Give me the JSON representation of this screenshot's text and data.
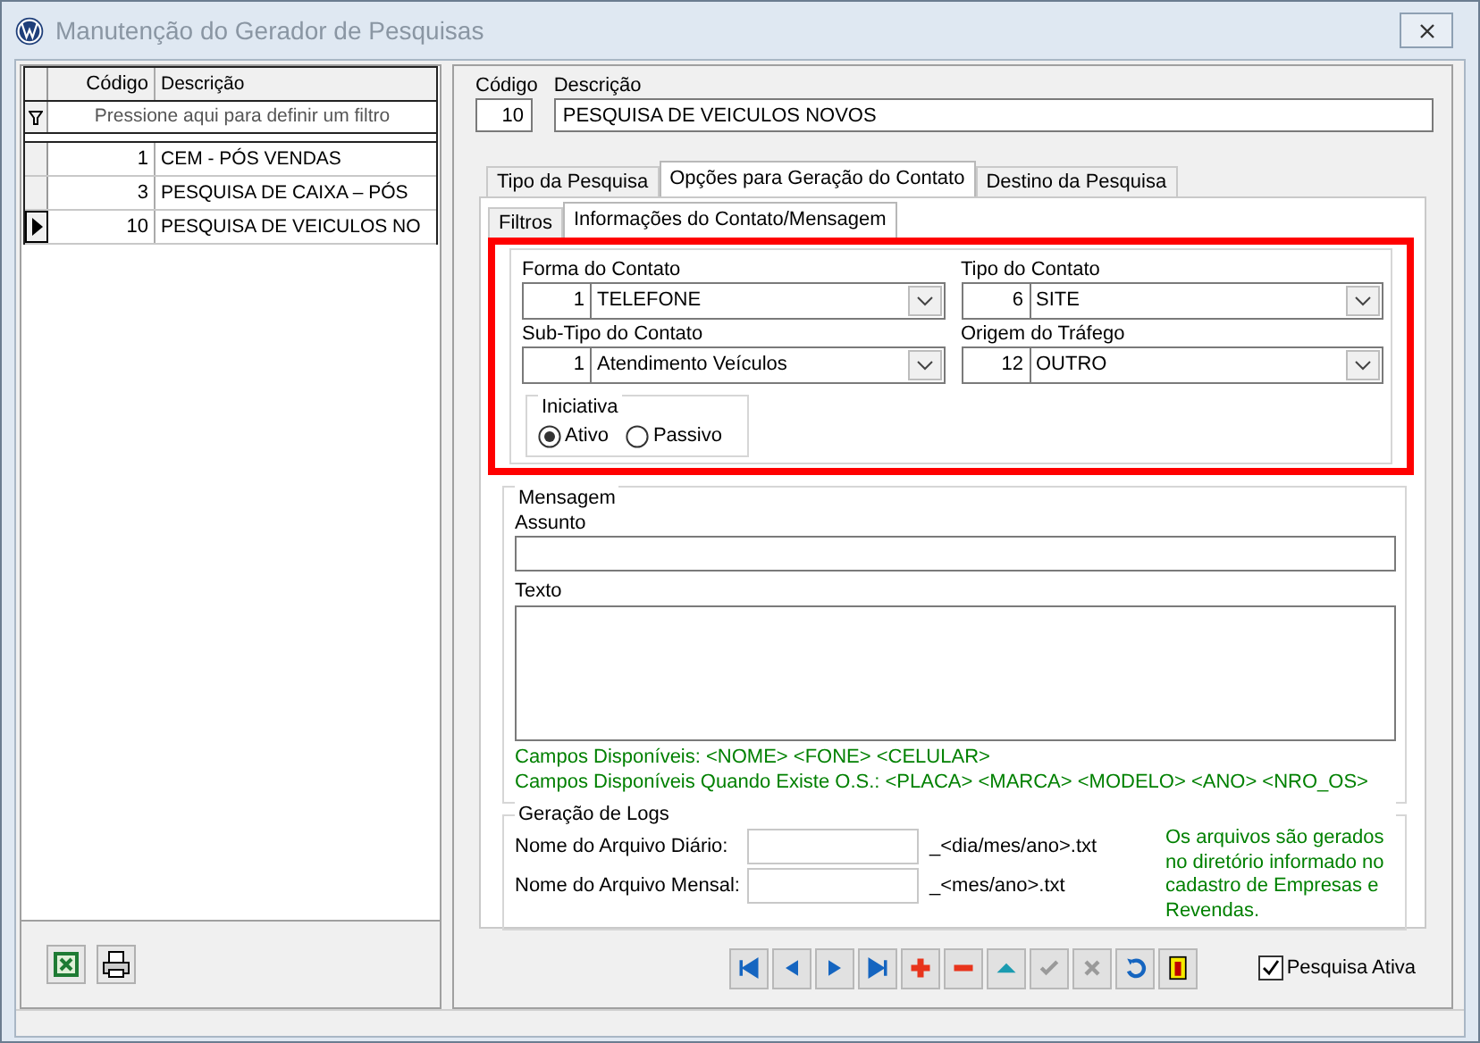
{
  "window": {
    "title": "Manutenção do Gerador de Pesquisas"
  },
  "grid": {
    "columns": [
      "Código",
      "Descrição"
    ],
    "filter_hint": "Pressione aqui para definir um filtro",
    "rows": [
      {
        "code": "1",
        "description": "CEM - PÓS VENDAS",
        "selected": false
      },
      {
        "code": "3",
        "description": "PESQUISA DE CAIXA – PÓS",
        "selected": false
      },
      {
        "code": "10",
        "description": "PESQUISA DE VEICULOS NO",
        "selected": true
      }
    ]
  },
  "record": {
    "code_label": "Código",
    "description_label": "Descrição",
    "code": "10",
    "description": "PESQUISA DE VEICULOS NOVOS"
  },
  "tabs": [
    {
      "label": "Tipo da Pesquisa",
      "selected": false
    },
    {
      "label": "Opções para Geração do Contato",
      "selected": true
    },
    {
      "label": "Destino da Pesquisa",
      "selected": false
    }
  ],
  "subtabs": [
    {
      "label": "Filtros",
      "selected": false
    },
    {
      "label": "Informações do Contato/Mensagem",
      "selected": true
    }
  ],
  "contact": {
    "highlighted": true,
    "fields": [
      {
        "label": "Forma do Contato",
        "code": "1",
        "value": "TELEFONE"
      },
      {
        "label": "Tipo do Contato",
        "code": "6",
        "value": "SITE"
      },
      {
        "label": "Sub-Tipo do Contato",
        "code": "1",
        "value": "Atendimento Veículos"
      },
      {
        "label": "Origem do Tráfego",
        "code": "12",
        "value": "OUTRO"
      }
    ],
    "initiative": {
      "title": "Iniciativa",
      "options": [
        {
          "label": "Ativo",
          "selected": true
        },
        {
          "label": "Passivo",
          "selected": false
        }
      ]
    }
  },
  "message": {
    "title": "Mensagem",
    "subject_label": "Assunto",
    "text_label": "Texto",
    "fields_line": "Campos Disponíveis:  <NOME> <FONE> <CELULAR>",
    "os_fields_line": "Campos Disponíveis Quando Existe O.S.:  <PLACA> <MARCA> <MODELO> <ANO> <NRO_OS>"
  },
  "logs": {
    "title": "Geração de Logs",
    "rows": [
      {
        "label": "Nome do Arquivo Diário:",
        "suffix": "_<dia/mes/ano>.txt"
      },
      {
        "label": "Nome do Arquivo Mensal:",
        "suffix": "_<mes/ano>.txt"
      }
    ],
    "note": "Os arquivos são gerados no diretório informado no cadastro de Empresas e Revendas."
  },
  "navigator": [
    {
      "kind": "first",
      "disabled": false
    },
    {
      "kind": "prev",
      "disabled": false
    },
    {
      "kind": "next",
      "disabled": false
    },
    {
      "kind": "last",
      "disabled": false
    },
    {
      "kind": "add",
      "disabled": false
    },
    {
      "kind": "delete",
      "disabled": false
    },
    {
      "kind": "edit",
      "disabled": false
    },
    {
      "kind": "confirm",
      "disabled": true
    },
    {
      "kind": "cancel",
      "disabled": true
    },
    {
      "kind": "refresh",
      "disabled": false
    },
    {
      "kind": "exit",
      "disabled": false
    }
  ],
  "active_checkbox": {
    "label": "Pesquisa Ativa",
    "checked": true
  }
}
